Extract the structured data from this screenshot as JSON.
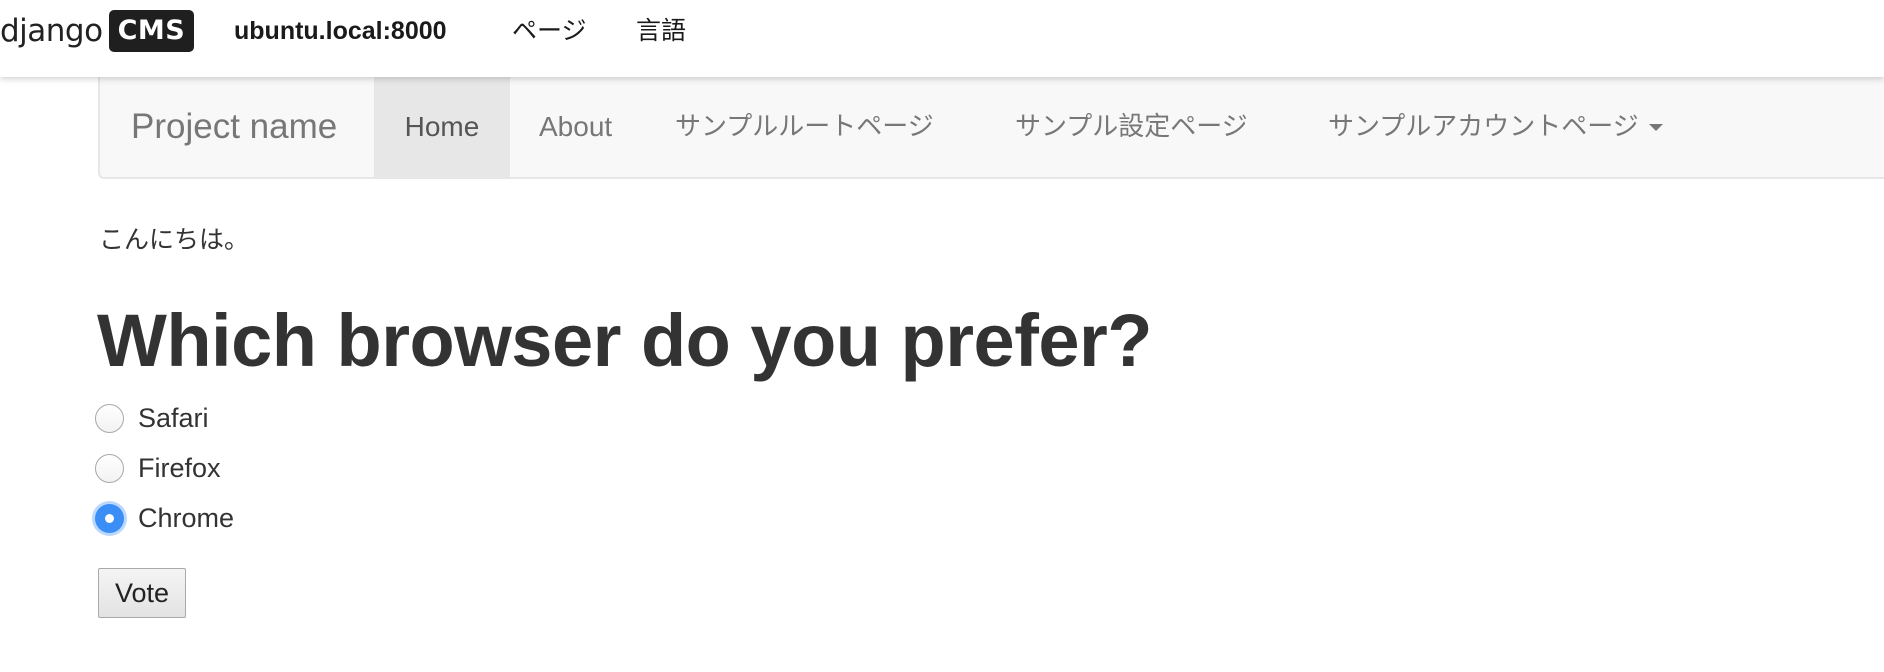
{
  "cms_toolbar": {
    "logo_word": "django",
    "logo_box": "CMS",
    "site_label": "ubuntu.local:8000",
    "pages_label": "ページ",
    "language_label": "言語"
  },
  "navbar": {
    "brand": "Project name",
    "items": [
      {
        "label": "Home",
        "active": true
      },
      {
        "label": "About",
        "active": false
      },
      {
        "label": "サンプルルートページ",
        "active": false
      },
      {
        "label": "サンプル設定ページ",
        "active": false
      },
      {
        "label": "サンプルアカウントページ",
        "active": false,
        "dropdown": true
      }
    ]
  },
  "content": {
    "greeting": "こんにちは。",
    "poll": {
      "question": "Which browser do you prefer?",
      "choices": [
        {
          "label": "Safari",
          "checked": false
        },
        {
          "label": "Firefox",
          "checked": false
        },
        {
          "label": "Chrome",
          "checked": true
        }
      ],
      "submit_label": "Vote"
    }
  },
  "colors": {
    "navbar_bg": "#f8f8f8",
    "navbar_active_bg": "#e7e7e7",
    "nav_text": "#777777",
    "radio_checked": "#3b8ef6",
    "cms_logo_box": "#1f1f1f"
  },
  "icons": {
    "dropdown": "caret-down-icon"
  }
}
